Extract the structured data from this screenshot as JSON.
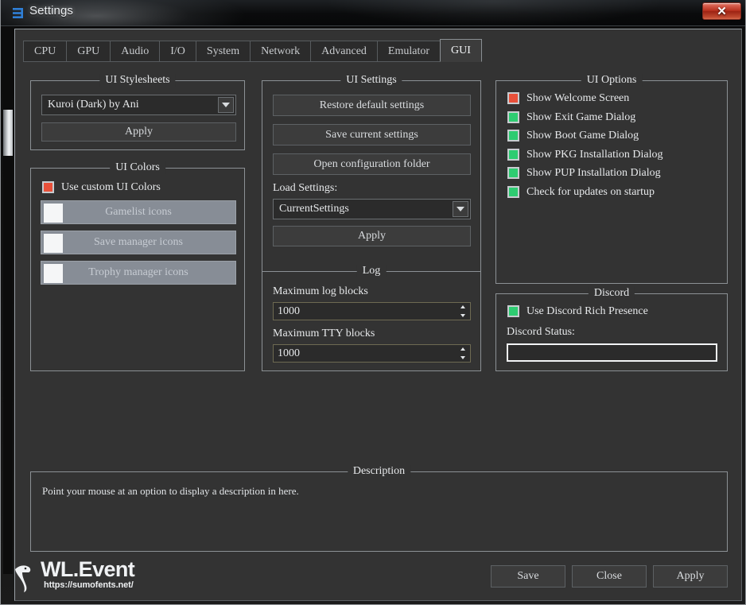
{
  "window": {
    "title": "Settings",
    "icon": "rpcs3-logo-icon",
    "close_label": "✕"
  },
  "tabs": [
    {
      "label": "CPU",
      "selected": false
    },
    {
      "label": "GPU",
      "selected": false
    },
    {
      "label": "Audio",
      "selected": false
    },
    {
      "label": "I/O",
      "selected": false
    },
    {
      "label": "System",
      "selected": false
    },
    {
      "label": "Network",
      "selected": false
    },
    {
      "label": "Advanced",
      "selected": false
    },
    {
      "label": "Emulator",
      "selected": false
    },
    {
      "label": "GUI",
      "selected": true
    }
  ],
  "ui_stylesheets": {
    "legend": "UI Stylesheets",
    "stylesheet_value": "Kuroi (Dark) by Ani",
    "apply_label": "Apply"
  },
  "ui_colors": {
    "legend": "UI Colors",
    "use_custom_label": "Use custom UI Colors",
    "use_custom_checked": false,
    "use_custom_color": "#e8503a",
    "buttons": [
      {
        "label": "Gamelist icons",
        "swatch": "#f5f6f7"
      },
      {
        "label": "Save manager icons",
        "swatch": "#f5f6f7"
      },
      {
        "label": "Trophy manager icons",
        "swatch": "#f5f6f7"
      }
    ]
  },
  "ui_settings": {
    "legend": "UI Settings",
    "restore_defaults_label": "Restore default settings",
    "save_current_label": "Save current settings",
    "open_config_folder_label": "Open configuration folder",
    "load_settings_label": "Load Settings:",
    "load_settings_value": "CurrentSettings",
    "apply_label": "Apply"
  },
  "log": {
    "legend": "Log",
    "max_log_blocks_label": "Maximum log blocks",
    "max_log_blocks_value": "1000",
    "max_tty_blocks_label": "Maximum TTY blocks",
    "max_tty_blocks_value": "1000"
  },
  "ui_options": {
    "legend": "UI Options",
    "checked_color": "#2ecc71",
    "unchecked_color": "#e8503a",
    "items": [
      {
        "label": "Show Welcome Screen",
        "checked": false
      },
      {
        "label": "Show Exit Game Dialog",
        "checked": true
      },
      {
        "label": "Show Boot Game Dialog",
        "checked": true
      },
      {
        "label": "Show PKG Installation Dialog",
        "checked": true
      },
      {
        "label": "Show PUP Installation Dialog",
        "checked": true
      },
      {
        "label": "Check for updates on startup",
        "checked": true
      }
    ]
  },
  "discord": {
    "legend": "Discord",
    "rich_presence_label": "Use Discord Rich Presence",
    "rich_presence_checked": true,
    "status_label": "Discord Status:",
    "status_value": ""
  },
  "description": {
    "legend": "Description",
    "text": "Point your mouse at an option to display a description in here."
  },
  "footer": {
    "save_label": "Save",
    "close_label": "Close",
    "apply_label": "Apply"
  },
  "watermark": {
    "title": "WL.Event",
    "url": "https://sumofents.net/"
  }
}
